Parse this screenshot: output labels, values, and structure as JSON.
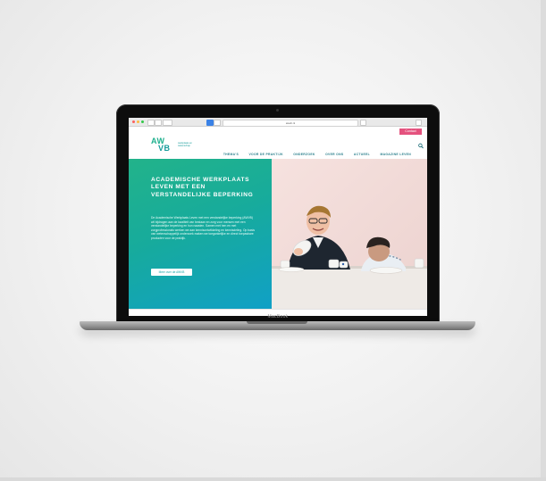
{
  "browser": {
    "url": "awvb.nl"
  },
  "header": {
    "contact_label": "Contact",
    "logo_top": "AW",
    "logo_bottom": "VB",
    "logo_tagline": "werkplaats en wetenschap",
    "nav": [
      "THEMA'S",
      "VOOR DE PRAKTIJK",
      "ONDERZOEK",
      "OVER ONS",
      "ACTUEEL",
      "MAGAZINE LEVEN"
    ]
  },
  "hero": {
    "title": "ACADEMISCHE WERKPLAATS LEVEN MET EEN VERSTANDELIJKE BEPERKING",
    "body": "De Academische Werkplaats Leven met een verstandelijke beperking (AWVB) wil bijdragen aan de kwaliteit van bestaan en zorg voor mensen met een verstandelijke beperking en hun naasten. Samen met hen en met zorgprofessionals werken we aan kennisontwikkeling en kennisdeling. Op basis van wetenschappelijk onderzoek maken we toegankelijke en direct toepasbare producten voor de praktijk.",
    "button_label": "Meer over de AWVB"
  },
  "device": {
    "brand": "MacBook"
  },
  "colors": {
    "accent_green": "#22b38a",
    "accent_teal": "#10a0c6",
    "contact_pink": "#e4527e",
    "nav_text": "#2a7f8c"
  },
  "icons": {
    "search": "search-icon"
  }
}
